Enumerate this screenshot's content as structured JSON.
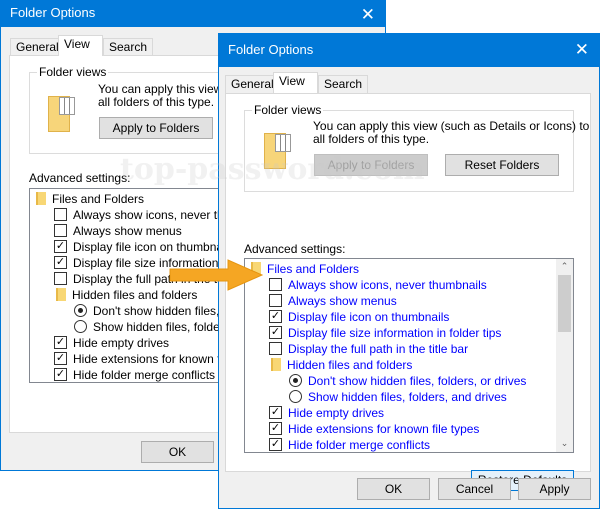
{
  "colors": {
    "titlebar": "#0078d7",
    "arrow": "#f5a623",
    "link_text": "#0000ff"
  },
  "watermark": "top-password.com",
  "back_window": {
    "title": "Folder Options",
    "tabs": [
      "General",
      "View",
      "Search"
    ],
    "active_tab": "View",
    "folder_views": {
      "label": "Folder views",
      "description_line1": "You can apply this view (s",
      "description_line2": "all folders of this type.",
      "apply_button": "Apply to Folders"
    },
    "advanced_label": "Advanced settings:",
    "items": [
      {
        "type": "folder",
        "label": "Files and Folders"
      },
      {
        "type": "checkbox",
        "checked": false,
        "label": "Always show icons, never thumbnails"
      },
      {
        "type": "checkbox",
        "checked": false,
        "label": "Always show menus"
      },
      {
        "type": "checkbox",
        "checked": true,
        "label": "Display file icon on thumbnails"
      },
      {
        "type": "checkbox",
        "checked": true,
        "label": "Display file size information in folder tips"
      },
      {
        "type": "checkbox",
        "checked": false,
        "label": "Display the full path in the title bar"
      },
      {
        "type": "folder",
        "label": "Hidden files and folders"
      },
      {
        "type": "radio",
        "checked": true,
        "label": "Don't show hidden files, folders, or drives"
      },
      {
        "type": "radio",
        "checked": false,
        "label": "Show hidden files, folders, and drives"
      },
      {
        "type": "checkbox",
        "checked": true,
        "label": "Hide empty drives"
      },
      {
        "type": "checkbox",
        "checked": true,
        "label": "Hide extensions for known file types"
      },
      {
        "type": "checkbox",
        "checked": true,
        "label": "Hide folder merge conflicts"
      }
    ],
    "ok_button": "OK"
  },
  "front_window": {
    "title": "Folder Options",
    "close_icon": "close-icon",
    "tabs": [
      "General",
      "View",
      "Search"
    ],
    "active_tab": "View",
    "folder_views": {
      "label": "Folder views",
      "description_line1": "You can apply this view (such as Details or Icons) to",
      "description_line2": "all folders of this type.",
      "apply_button": "Apply to Folders",
      "apply_disabled": true,
      "reset_button": "Reset Folders"
    },
    "advanced_label": "Advanced settings:",
    "items": [
      {
        "type": "folder",
        "label": "Files and Folders"
      },
      {
        "type": "checkbox",
        "checked": false,
        "label": "Always show icons, never thumbnails"
      },
      {
        "type": "checkbox",
        "checked": false,
        "label": "Always show menus"
      },
      {
        "type": "checkbox",
        "checked": true,
        "label": "Display file icon on thumbnails"
      },
      {
        "type": "checkbox",
        "checked": true,
        "label": "Display file size information in folder tips"
      },
      {
        "type": "checkbox",
        "checked": false,
        "label": "Display the full path in the title bar"
      },
      {
        "type": "folder",
        "label": "Hidden files and folders"
      },
      {
        "type": "radio",
        "checked": true,
        "label": "Don't show hidden files, folders, or drives"
      },
      {
        "type": "radio",
        "checked": false,
        "label": "Show hidden files, folders, and drives"
      },
      {
        "type": "checkbox",
        "checked": true,
        "label": "Hide empty drives"
      },
      {
        "type": "checkbox",
        "checked": true,
        "label": "Hide extensions for known file types"
      },
      {
        "type": "checkbox",
        "checked": true,
        "label": "Hide folder merge conflicts"
      }
    ],
    "restore_button": "Restore Defaults",
    "ok_button": "OK",
    "cancel_button": "Cancel",
    "apply_button": "Apply"
  }
}
